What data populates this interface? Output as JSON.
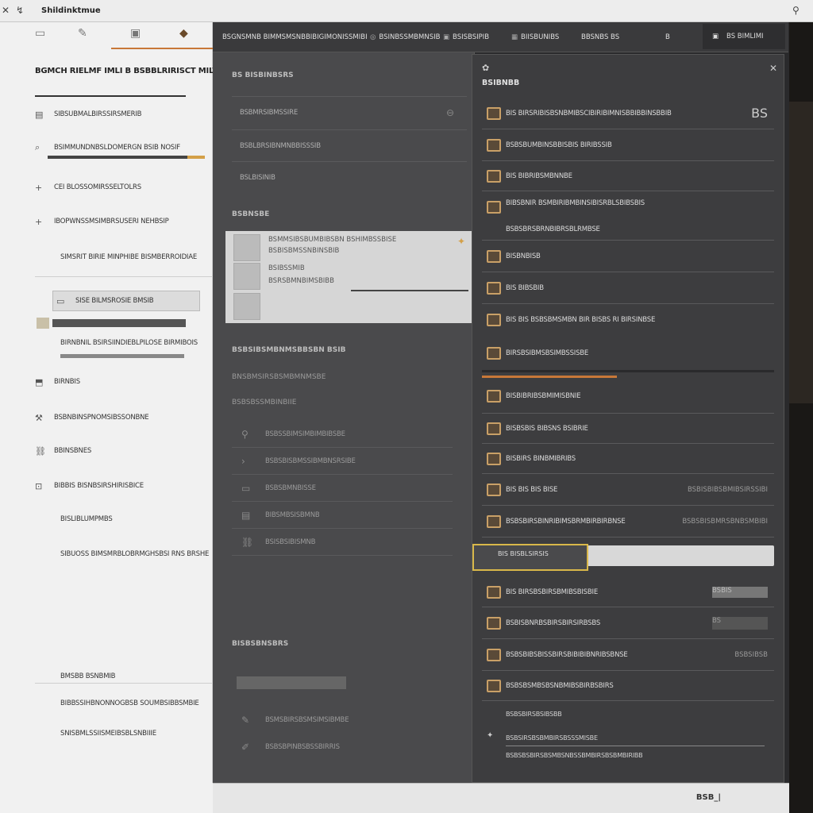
{
  "titlebar": {
    "title": "Shildinktmue"
  },
  "left": {
    "heading": "BGMCH RIELMF IMLI B BSBBLRIRISCT MILT",
    "items": [
      {
        "icon": "folder-icon",
        "label": "SIBSUBMALBIRSSIRSMERIB"
      },
      {
        "icon": "search-icon",
        "label": "BSIMMUNDNBSLDOMERGN BSIB NOSIF"
      },
      {
        "icon": "plus-icon",
        "label": "CEI BLOSSOMIRSSELTOLRS"
      },
      {
        "icon": "plus-icon",
        "label": "IBOPWNSSMSIMBRSUSERI NEHBSIP"
      },
      {
        "icon": "",
        "label": "SIMSRIT BIRIE MINPHIBE BISMBERROIDIAE"
      },
      {
        "icon": "monitor-icon",
        "label": "SISE BILMSROSIE BMSIB"
      },
      {
        "icon": "",
        "label": "BIRNBNIL BSIRSIINDIEBLPILOSE BIRMIBOIS"
      },
      {
        "icon": "tag-icon",
        "label": "BIRNBIS"
      },
      {
        "icon": "tool-icon",
        "label": "BSBNBINSPNOMSIBSSONBNE"
      },
      {
        "icon": "link-icon",
        "label": "BBINSBNES"
      },
      {
        "icon": "lock-icon",
        "label": "BIBBIS BISNBSIRSHIRISBICE"
      },
      {
        "icon": "",
        "label": "BISLIBLUMPMBS"
      },
      {
        "icon": "",
        "label": "SIBUOSS BIMSMRBLOBRMGHSBSI RNS BRSHE"
      },
      {
        "icon": "",
        "label": "BMSBB BSNBMIB"
      },
      {
        "icon": "",
        "label": "BIBBSSIHBNONNOGBSB SOUMBSIBBSMBIE"
      },
      {
        "icon": "",
        "label": "SNISBMLSSIISMEIBSBLSNBIIIE"
      }
    ]
  },
  "midtop": {
    "tabs": [
      "BSGNSMNB BIMMSMSNBBIBIGIMONISSMIBI",
      "BSINBSSMBMNSIB",
      "BSISBSIPIB",
      "BIISBUNIBS",
      "BBSNBS BS",
      "B"
    ],
    "button": "BS BIMLIMI"
  },
  "mid": {
    "section1": "BS BISBINBSRS",
    "rows1": [
      "BSBMRSIBMSSIRE",
      "BSBLBRSIBNMNBBISSSIB",
      "BSLBISINIB"
    ],
    "section2": "BSBNSBE",
    "card": [
      "BSMMSIBSBUMBIBSBN BSHIMBSSBISE",
      "BSBISBMSSNBINSBIB",
      "BSIBSSMIB",
      "BSRSBMNBIMSBIBB"
    ],
    "section3": "BSBSIBSMBNMSBBSBN BSIB",
    "sub3": [
      "BNSBMSIRSBSMBMNMSBE",
      "BSBSBSSMBINBIIE"
    ],
    "rows2": [
      "BSBSSBIMSIMBIMBIBSBE",
      "BSBSBISBMSSIBMBNSRSIBE",
      "BSBSBMNBISSE",
      "BIBSMBSISBMNB",
      "BSISBSIBISMNB"
    ],
    "section4": "BISBSBNSBRS",
    "rows3": [
      "BSMSBIRSBSMSIMSIBMBE",
      "BSBSBPINBSBSSBIRRIS"
    ]
  },
  "rp": {
    "title": "BSIBNBB",
    "rows": [
      {
        "label": "BIS BIRSRIBISBSNBMIBSCIBIRIBIMNISBBIBBINSBBIB",
        "value": "BS"
      },
      {
        "label": "BSBSBUMBINSBBISBIS BIRIBSSIB",
        "value": ""
      },
      {
        "label": "BIS BIBRIBSMBNNBE",
        "value": ""
      },
      {
        "label": "BIBSBNIR BSMBIRIBMBINSIBISRBLSBIBSBIS",
        "value": ""
      },
      {
        "label": "BSBSBRSBRNBIBRSBLRMBSE",
        "value": ""
      },
      {
        "label": "BISBNBISB",
        "value": ""
      },
      {
        "label": "BIS BIBSBIB",
        "value": ""
      },
      {
        "label": "BIS BIS BSBSBMSMBN BIR BISBS RI BIRSINBSE",
        "value": ""
      },
      {
        "label": "BIRSBSIBMSBSIMBSSISBE",
        "value": ""
      },
      {
        "label": "BISBIBRIBSBMIMISBNIE",
        "value": ""
      },
      {
        "label": "BISBSBIS BIBSNS BSIBRIE",
        "value": ""
      },
      {
        "label": "BISBIRS BINBMIBRIBS",
        "value": ""
      },
      {
        "label": "BIS BIS BIS BISE",
        "value": "BSBISBIBSBMIBSIRSSIBI"
      },
      {
        "label": "BSBSBIRSBINRIBIMSBRMBIRBIRBNSE",
        "value": "BSBSBISBMRSBNBSMBIBI"
      }
    ],
    "input": {
      "label": "BIS BISBLSIRSIS"
    },
    "rows2": [
      {
        "label": "BIS BIRSBSBIRSBMIBSBISBIE",
        "value": "BSBIS"
      },
      {
        "label": "BSBISBNRBSBIRSBIRSIRBSBS",
        "value": "BS"
      },
      {
        "label": "BSBSBIBSBISSBIRSBIBIBIBNRIBSBNSE",
        "value": "BSBSIBSB"
      },
      {
        "label": "BSBSBSMBSBSNBMIBSBIRBSBIRS",
        "value": ""
      }
    ],
    "foot": [
      "BSBSBIRSBSIBSBB",
      "BSBSIRSBSBMBIRSBSSSMISBE",
      "BSBSBSBIRSBSMBSNBSSBMBIRSBSBMBIRIBB"
    ]
  },
  "bottom": {
    "page": "BSB_|"
  }
}
